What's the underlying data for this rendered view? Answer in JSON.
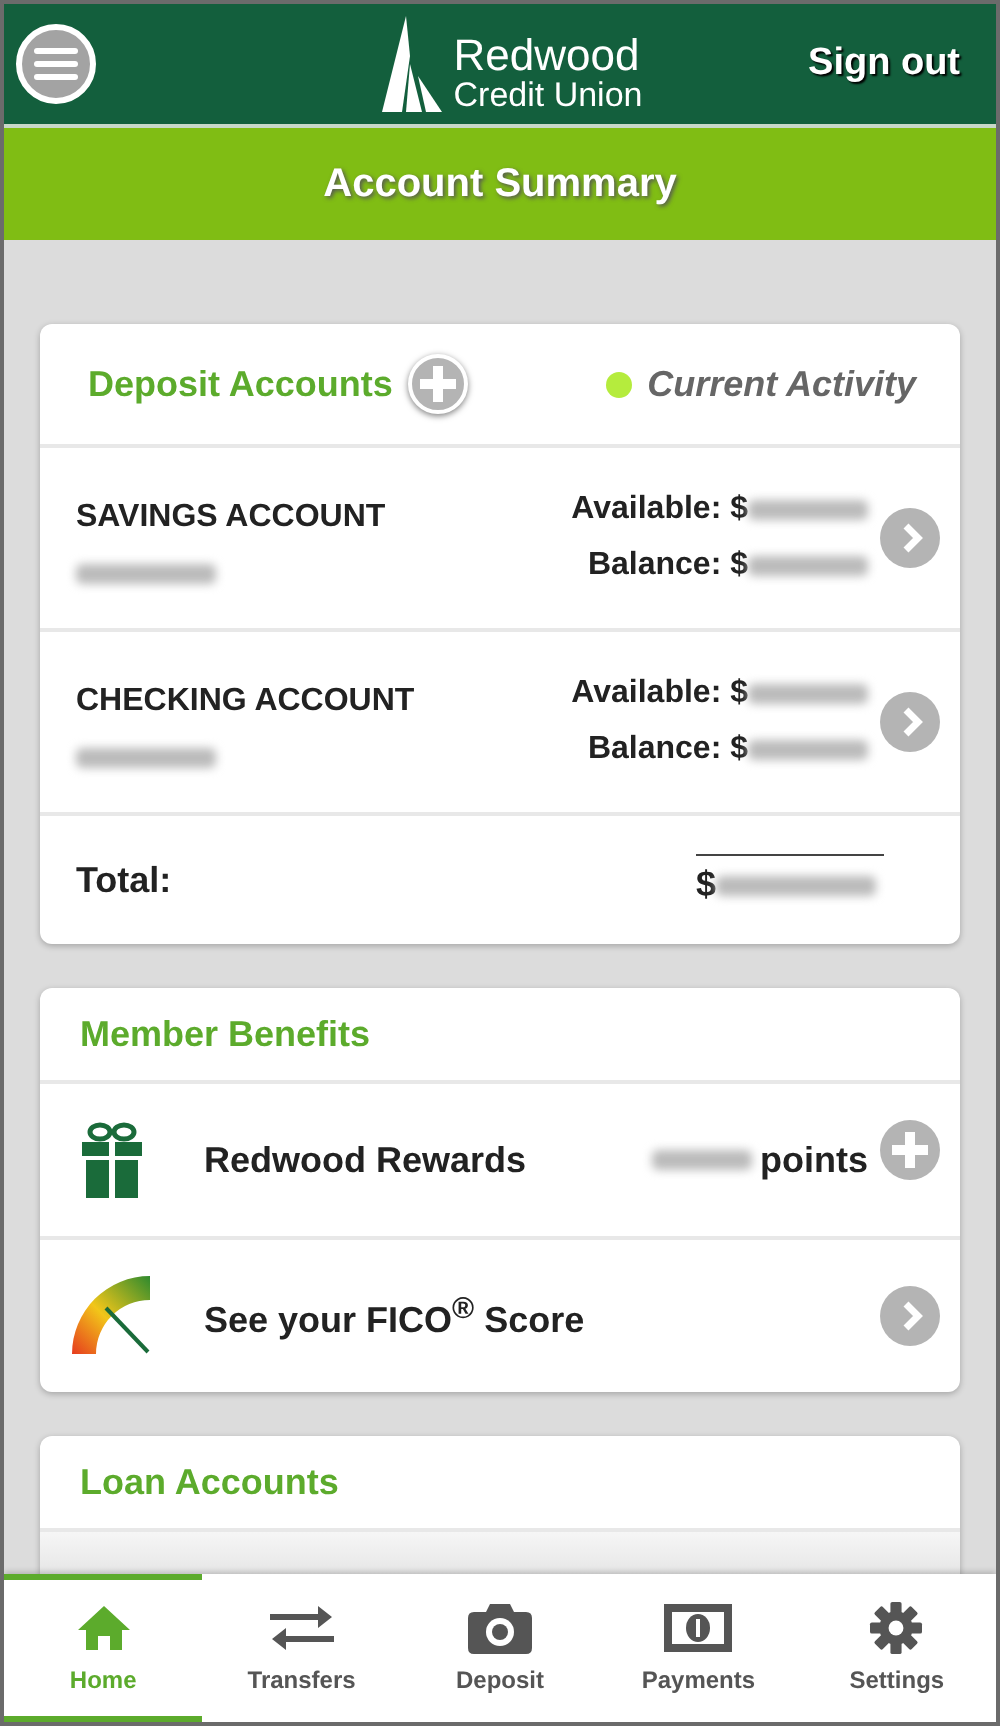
{
  "header": {
    "logo_line1": "Redwood",
    "logo_line2": "Credit Union",
    "sign_out": "Sign out"
  },
  "page_title": "Account Summary",
  "deposit": {
    "title": "Deposit Accounts",
    "activity": "Current Activity",
    "accounts": [
      {
        "name": "SAVINGS ACCOUNT",
        "available_label": "Available: $",
        "balance_label": "Balance: $"
      },
      {
        "name": "CHECKING ACCOUNT",
        "available_label": "Available: $",
        "balance_label": "Balance: $"
      }
    ],
    "total_label": "Total:",
    "total_prefix": "$"
  },
  "benefits": {
    "title": "Member Benefits",
    "items": [
      {
        "kind": "rewards",
        "label": "Redwood Rewards",
        "suffix": "points"
      },
      {
        "kind": "fico",
        "label": "See your FICO$^{®}$ Score"
      }
    ]
  },
  "loans": {
    "title": "Loan Accounts"
  },
  "tabs": [
    {
      "label": "Home",
      "kind": "home",
      "selected": true
    },
    {
      "label": "Transfers",
      "kind": "transfers",
      "selected": false
    },
    {
      "label": "Deposit",
      "kind": "camera",
      "selected": false
    },
    {
      "label": "Payments",
      "kind": "money",
      "selected": false
    },
    {
      "label": "Settings",
      "kind": "gear",
      "selected": false
    }
  ]
}
